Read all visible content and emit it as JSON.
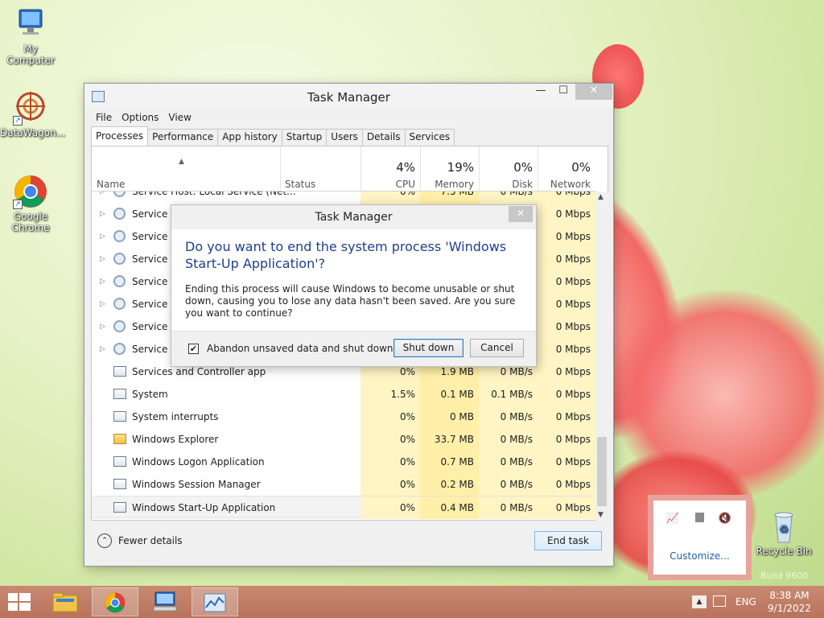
{
  "desktop": {
    "icons": [
      {
        "label": "My Computer"
      },
      {
        "label": "DataWagon..."
      },
      {
        "label": "Google Chrome"
      },
      {
        "label": "Recycle Bin"
      }
    ],
    "watermark": "Build 9600"
  },
  "task_manager": {
    "title": "Task Manager",
    "menu": [
      "File",
      "Options",
      "View"
    ],
    "tabs": [
      "Processes",
      "Performance",
      "App history",
      "Startup",
      "Users",
      "Details",
      "Services"
    ],
    "active_tab": "Processes",
    "columns": {
      "name": "Name",
      "status": "Status",
      "cpu": {
        "pct": "4%",
        "label": "CPU"
      },
      "memory": {
        "pct": "19%",
        "label": "Memory"
      },
      "disk": {
        "pct": "0%",
        "label": "Disk"
      },
      "network": {
        "pct": "0%",
        "label": "Network"
      }
    },
    "rows": [
      {
        "name": "Service Host: Local Service (Net...",
        "cpu": "0%",
        "memory": "7.5 MB",
        "disk": "0 MB/s",
        "network": "0 Mbps",
        "icon": "gear-icon",
        "expandable": true
      },
      {
        "name": "Service H",
        "cpu": "",
        "memory": "",
        "disk": "",
        "network": "0 Mbps",
        "icon": "gear-icon",
        "expandable": true
      },
      {
        "name": "Service H",
        "cpu": "",
        "memory": "",
        "disk": "",
        "network": "0 Mbps",
        "icon": "gear-icon",
        "expandable": true
      },
      {
        "name": "Service H",
        "cpu": "",
        "memory": "",
        "disk": "",
        "network": "0 Mbps",
        "icon": "gear-icon",
        "expandable": true
      },
      {
        "name": "Service H",
        "cpu": "",
        "memory": "",
        "disk": "",
        "network": "0 Mbps",
        "icon": "gear-icon",
        "expandable": true
      },
      {
        "name": "Service H",
        "cpu": "",
        "memory": "",
        "disk": "",
        "network": "0 Mbps",
        "icon": "gear-icon",
        "expandable": true
      },
      {
        "name": "Service H",
        "cpu": "",
        "memory": "",
        "disk": "",
        "network": "0 Mbps",
        "icon": "gear-icon",
        "expandable": true
      },
      {
        "name": "Service H",
        "cpu": "",
        "memory": "",
        "disk": "",
        "network": "0 Mbps",
        "icon": "gear-icon",
        "expandable": true
      },
      {
        "name": "Services and Controller app",
        "cpu": "0%",
        "memory": "1.9 MB",
        "disk": "0 MB/s",
        "network": "0 Mbps",
        "icon": "window-icon",
        "expandable": false
      },
      {
        "name": "System",
        "cpu": "1.5%",
        "memory": "0.1 MB",
        "disk": "0.1 MB/s",
        "network": "0 Mbps",
        "icon": "window-icon",
        "expandable": false
      },
      {
        "name": "System interrupts",
        "cpu": "0%",
        "memory": "0 MB",
        "disk": "0 MB/s",
        "network": "0 Mbps",
        "icon": "window-icon",
        "expandable": false
      },
      {
        "name": "Windows Explorer",
        "cpu": "0%",
        "memory": "33.7 MB",
        "disk": "0 MB/s",
        "network": "0 Mbps",
        "icon": "folder-icon",
        "expandable": false
      },
      {
        "name": "Windows Logon Application",
        "cpu": "0%",
        "memory": "0.7 MB",
        "disk": "0 MB/s",
        "network": "0 Mbps",
        "icon": "window-icon",
        "expandable": false
      },
      {
        "name": "Windows Session Manager",
        "cpu": "0%",
        "memory": "0.2 MB",
        "disk": "0 MB/s",
        "network": "0 Mbps",
        "icon": "window-icon",
        "expandable": false
      },
      {
        "name": "Windows Start-Up Application",
        "cpu": "0%",
        "memory": "0.4 MB",
        "disk": "0 MB/s",
        "network": "0 Mbps",
        "icon": "window-icon",
        "expandable": false,
        "selected": true
      }
    ],
    "fewer_details": "Fewer details",
    "end_task": "End task"
  },
  "dialog": {
    "title": "Task Manager",
    "question": "Do you want to end the system process 'Windows Start-Up Application'?",
    "body": "Ending this process will cause Windows to become unusable or shut down, causing you to lose any data hasn't been saved. Are you sure you want to continue?",
    "checkbox_label": "Abandon unsaved data and shut down.",
    "checkbox_checked": true,
    "shutdown_label": "Shut down",
    "cancel_label": "Cancel"
  },
  "tray_popup": {
    "customize_label": "Customize..."
  },
  "taskbar": {
    "language": "ENG",
    "time": "8:38 AM",
    "date": "9/1/2022"
  }
}
